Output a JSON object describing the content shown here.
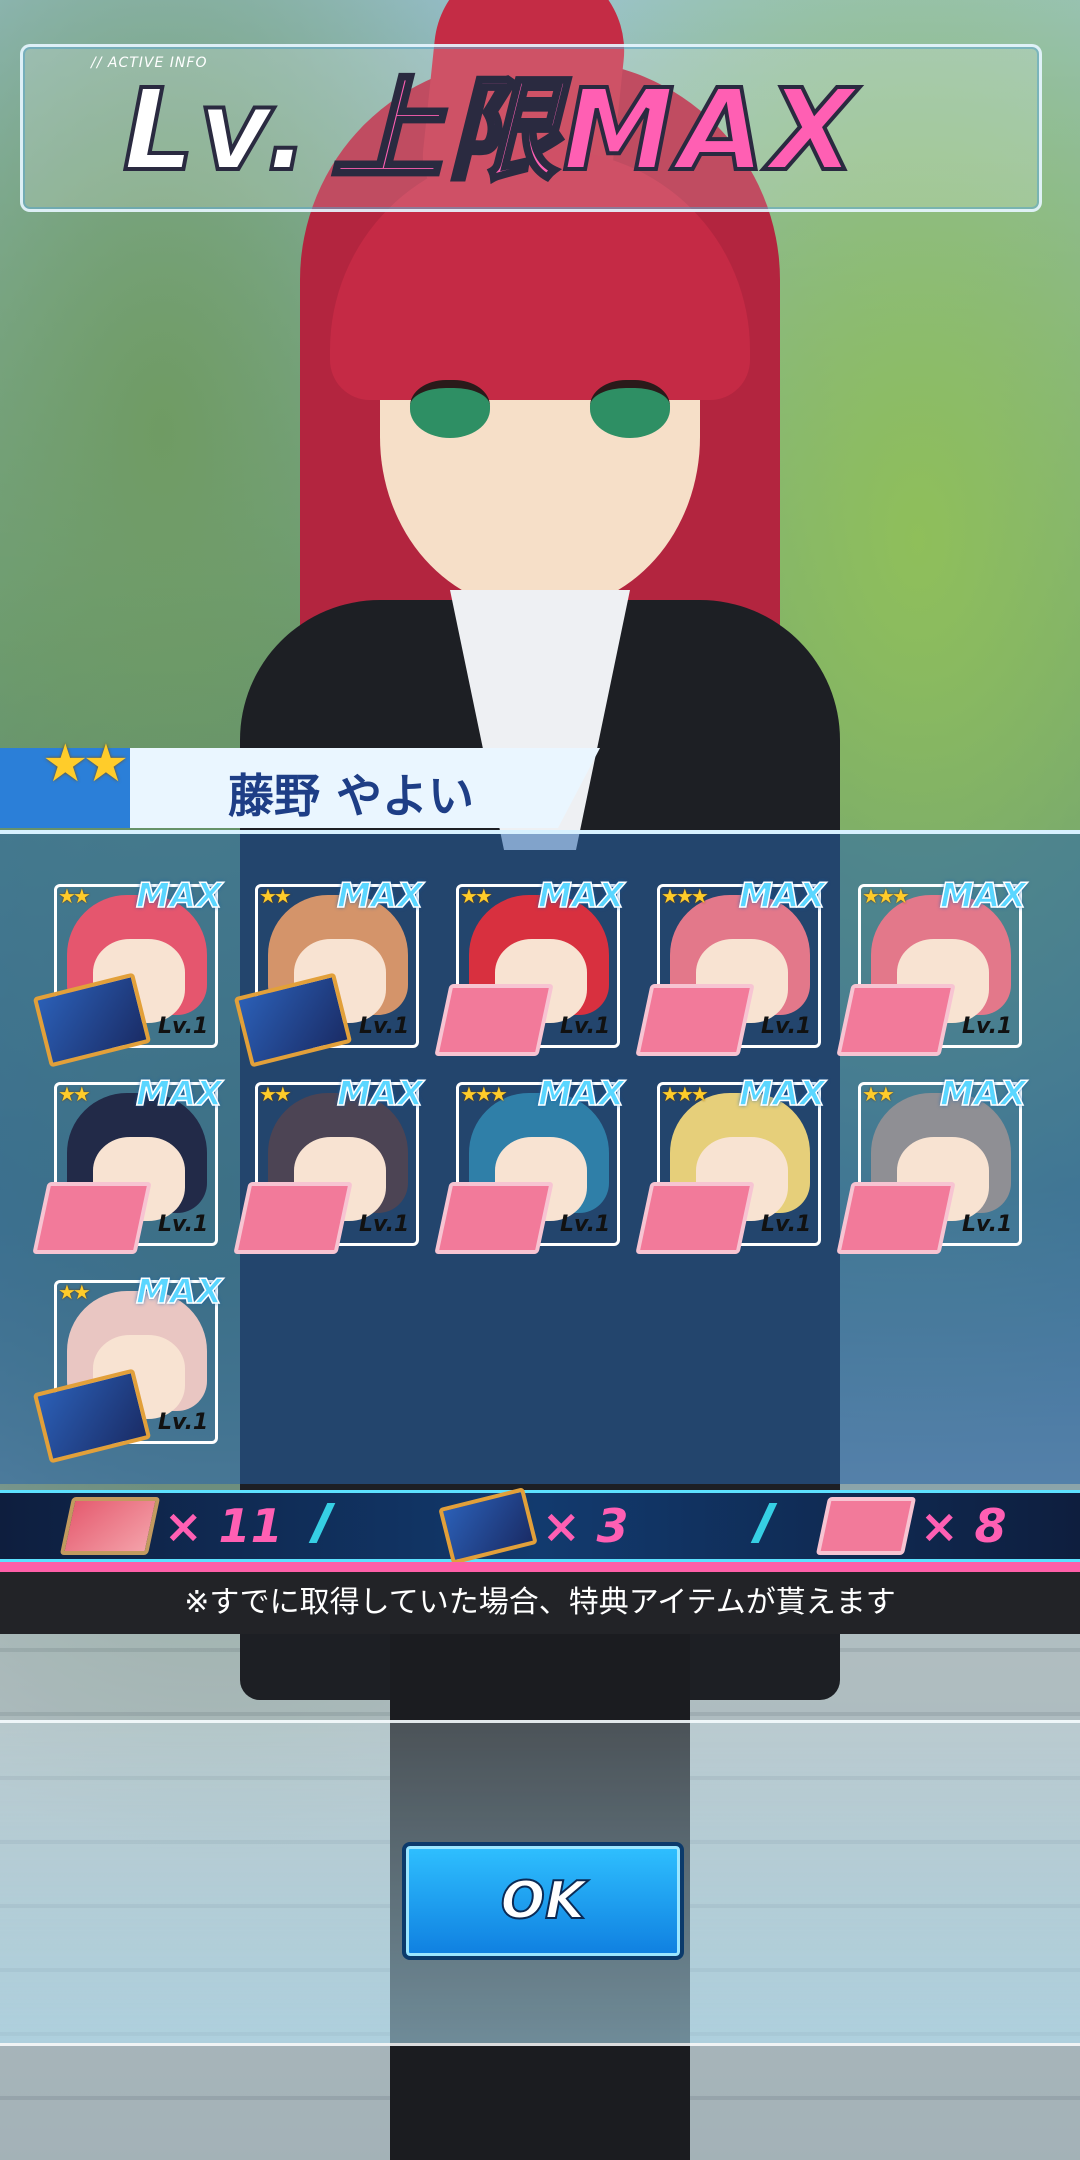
{
  "title": {
    "sub": "// ACTIVE INFO",
    "lv": "Lv.",
    "main": "上限MAX"
  },
  "character": {
    "name": "藤野 やよい",
    "stars": "★★"
  },
  "cards": [
    {
      "stars": "★★",
      "max": "MAX",
      "lv": "Lv.1",
      "item": "book",
      "hair": "#e5566e"
    },
    {
      "stars": "★★",
      "max": "MAX",
      "lv": "Lv.1",
      "item": "book",
      "hair": "#d4946a"
    },
    {
      "stars": "★★",
      "max": "MAX",
      "lv": "Lv.1",
      "item": "ticket",
      "hair": "#d8303f"
    },
    {
      "stars": "★★★",
      "max": "MAX",
      "lv": "Lv.1",
      "item": "ticket",
      "hair": "#e3788a"
    },
    {
      "stars": "★★★",
      "max": "MAX",
      "lv": "Lv.1",
      "item": "ticket",
      "hair": "#e3788a"
    },
    {
      "stars": "★★",
      "max": "MAX",
      "lv": "Lv.1",
      "item": "ticket",
      "hair": "#222a48"
    },
    {
      "stars": "★★",
      "max": "MAX",
      "lv": "Lv.1",
      "item": "ticket",
      "hair": "#4c4454"
    },
    {
      "stars": "★★★",
      "max": "MAX",
      "lv": "Lv.1",
      "item": "ticket",
      "hair": "#2f7fa8"
    },
    {
      "stars": "★★★",
      "max": "MAX",
      "lv": "Lv.1",
      "item": "ticket",
      "hair": "#e6cf7a"
    },
    {
      "stars": "★★",
      "max": "MAX",
      "lv": "Lv.1",
      "item": "ticket",
      "hair": "#8f8f94"
    },
    {
      "stars": "★★",
      "max": "MAX",
      "lv": "Lv.1",
      "item": "book",
      "hair": "#e9c6c2"
    }
  ],
  "summary": [
    {
      "icon": "meat",
      "count": "× 11"
    },
    {
      "icon": "book",
      "count": "× 3"
    },
    {
      "icon": "ticket",
      "count": "× 8"
    }
  ],
  "notice": "※すでに取得していた場合、特典アイテムが貰えます",
  "ok_label": "OK",
  "colors": {
    "accent_pink": "#ff5fb3",
    "accent_cyan": "#5ad6ff",
    "button_blue": "#1a9bf0"
  }
}
